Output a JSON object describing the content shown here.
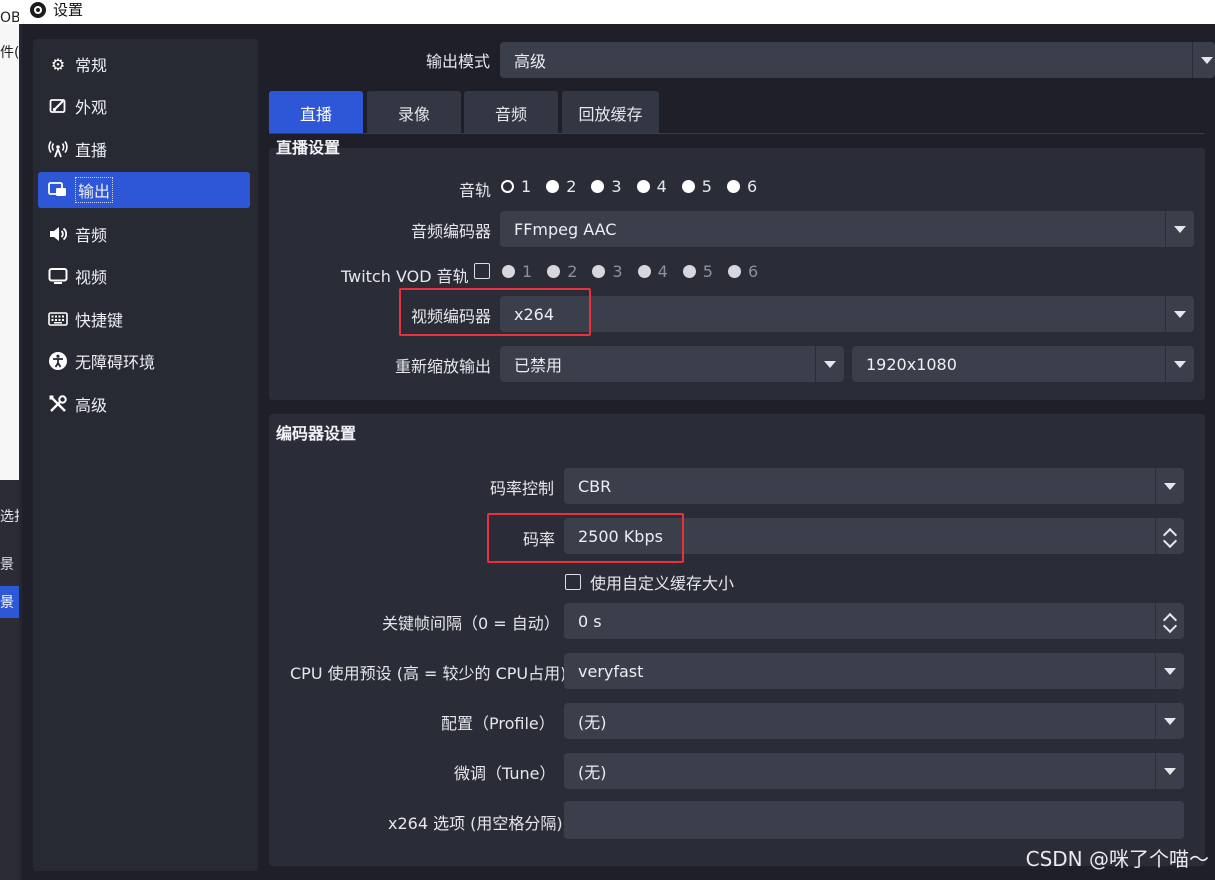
{
  "window": {
    "title": "设置"
  },
  "background_window": {
    "fragments": [
      "OB",
      "件(F",
      "选扫",
      "景",
      "景"
    ]
  },
  "sidebar": {
    "items": [
      {
        "label": "常规",
        "icon": "gear-icon",
        "active": false
      },
      {
        "label": "外观",
        "icon": "appearance-icon",
        "active": false
      },
      {
        "label": "直播",
        "icon": "broadcast-icon",
        "active": false
      },
      {
        "label": "输出",
        "icon": "output-icon",
        "active": true
      },
      {
        "label": "音频",
        "icon": "speaker-icon",
        "active": false
      },
      {
        "label": "视频",
        "icon": "monitor-icon",
        "active": false
      },
      {
        "label": "快捷键",
        "icon": "keyboard-icon",
        "active": false
      },
      {
        "label": "无障碍环境",
        "icon": "accessibility-icon",
        "active": false
      },
      {
        "label": "高级",
        "icon": "tools-icon",
        "active": false
      }
    ]
  },
  "output_mode": {
    "label": "输出模式",
    "value": "高级"
  },
  "tabs": [
    {
      "label": "直播",
      "active": true
    },
    {
      "label": "录像",
      "active": false
    },
    {
      "label": "音频",
      "active": false
    },
    {
      "label": "回放缓存",
      "active": false
    }
  ],
  "stream_settings": {
    "title_partial": "直播设置",
    "audio_track": {
      "label": "音轨",
      "options": [
        "1",
        "2",
        "3",
        "4",
        "5",
        "6"
      ],
      "selected": "1"
    },
    "audio_encoder": {
      "label": "音频编码器",
      "value": "FFmpeg AAC"
    },
    "twitch_vod": {
      "label": "Twitch VOD 音轨",
      "options": [
        "1",
        "2",
        "3",
        "4",
        "5",
        "6"
      ],
      "checked": false
    },
    "video_encoder": {
      "label": "视频编码器",
      "value": "x264"
    },
    "rescale": {
      "label": "重新缩放输出",
      "value": "已禁用",
      "resolution": "1920x1080"
    }
  },
  "encoder_settings": {
    "title": "编码器设置",
    "rate_control": {
      "label": "码率控制",
      "value": "CBR"
    },
    "bitrate": {
      "label": "码率",
      "value": "2500 Kbps"
    },
    "custom_buffer": {
      "label": "使用自定义缓存大小",
      "checked": false
    },
    "keyframe": {
      "label": "关键帧间隔（0 = 自动）",
      "value": "0 s"
    },
    "cpu_preset": {
      "label": "CPU 使用预设 (高 = 较少的 CPU占用)",
      "value": "veryfast"
    },
    "profile": {
      "label": "配置（Profile）",
      "value": "(无)"
    },
    "tune": {
      "label": "微调（Tune）",
      "value": "(无)"
    },
    "x264_opts": {
      "label": "x264 选项 (用空格分隔)",
      "value": ""
    }
  },
  "watermark": "CSDN @咪了个喵～",
  "colors": {
    "accent": "#2d57d6",
    "highlight_box": "#e8313a",
    "panel": "#2a2d37",
    "field": "#3b3e4b"
  }
}
